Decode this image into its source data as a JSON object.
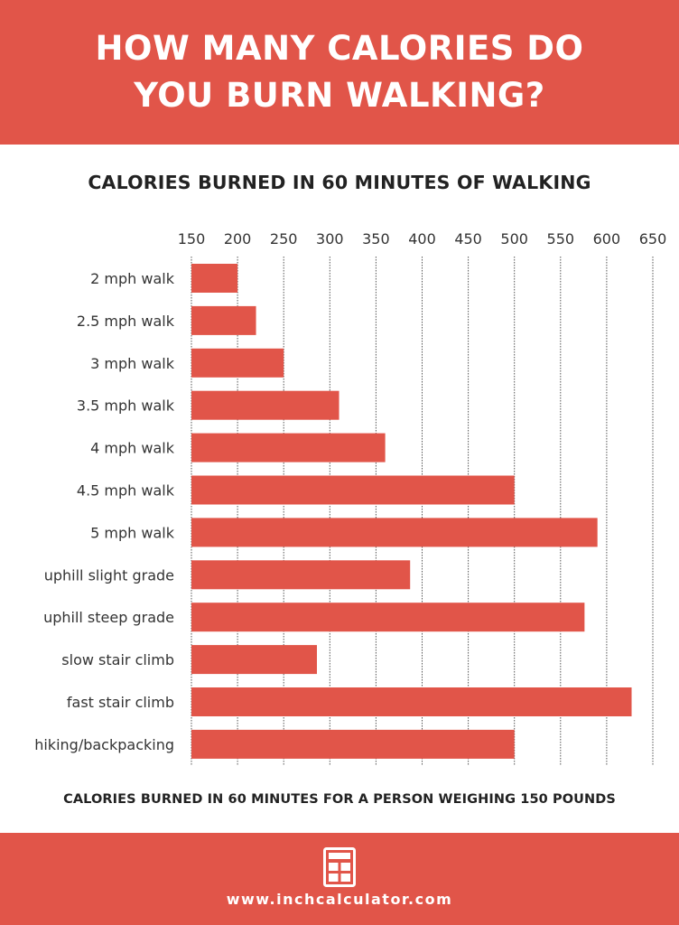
{
  "header": {
    "title": "HOW MANY CALORIES DO YOU BURN WALKING?"
  },
  "footer": {
    "icon": "calculator-icon",
    "url": "www.inchcalculator.com"
  },
  "colors": {
    "accent": "#E15549",
    "bar": "#E15549",
    "text": "#222222",
    "grid": "#555555"
  },
  "chart_data": {
    "type": "bar",
    "orientation": "horizontal",
    "title": "CALORIES BURNED IN 60 MINUTES OF WALKING",
    "xlabel": "CALORIES BURNED IN 60 MINUTES FOR A PERSON WEIGHING 150 POUNDS",
    "ylabel": "",
    "xlim": [
      150,
      650
    ],
    "x_ticks": [
      150,
      200,
      250,
      300,
      350,
      400,
      450,
      500,
      550,
      600,
      650
    ],
    "x_axis_position": "top",
    "grid": "vertical dotted",
    "legend": "none",
    "categories": [
      "2 mph walk",
      "2.5 mph walk",
      "3 mph walk",
      "3.5 mph walk",
      "4 mph walk",
      "4.5 mph walk",
      "5 mph walk",
      "uphill slight grade",
      "uphill steep grade",
      "slow stair climb",
      "fast stair climb",
      "hiking/backpacking"
    ],
    "values": [
      200,
      220,
      250,
      310,
      360,
      500,
      590,
      387,
      576,
      286,
      627,
      500
    ]
  }
}
